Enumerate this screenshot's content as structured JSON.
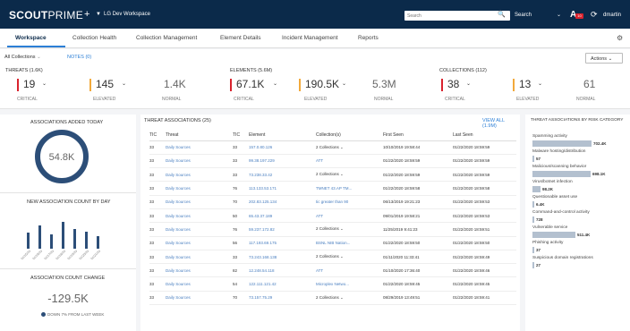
{
  "topbar": {
    "logo_bold": "SCOUT",
    "logo_thin": "PRIME",
    "workspace": "LG Dev Workspace",
    "search_placeholder": "Search",
    "search_select": "Search",
    "alert_count": "10",
    "user": "dmartin"
  },
  "tabs": [
    {
      "label": "Workspace"
    },
    {
      "label": "Collection Health"
    },
    {
      "label": "Collection Management"
    },
    {
      "label": "Element Details"
    },
    {
      "label": "Incident Management"
    },
    {
      "label": "Reports"
    }
  ],
  "filter": {
    "collections": "All Collections",
    "notes": "NOTES (0)",
    "actions": "Actions"
  },
  "stats": {
    "threats": {
      "title": "THREATS (1.6K)",
      "items": [
        {
          "value": "19",
          "label": "CRITICAL",
          "color": "#d9232e"
        },
        {
          "value": "145",
          "label": "ELEVATED",
          "color": "#f2a93b"
        },
        {
          "value": "1.4K",
          "label": "NORMAL",
          "color": ""
        }
      ]
    },
    "elements": {
      "title": "ELEMENTS (5.6M)",
      "items": [
        {
          "value": "67.1K",
          "label": "CRITICAL",
          "color": "#d9232e"
        },
        {
          "value": "190.5K",
          "label": "ELEVATED",
          "color": "#f2a93b"
        },
        {
          "value": "5.3M",
          "label": "NORMAL",
          "color": ""
        }
      ]
    },
    "collections": {
      "title": "COLLECTIONS (112)",
      "items": [
        {
          "value": "38",
          "label": "CRITICAL",
          "color": "#d9232e"
        },
        {
          "value": "13",
          "label": "ELEVATED",
          "color": "#f2a93b"
        },
        {
          "value": "61",
          "label": "NORMAL",
          "color": ""
        }
      ]
    }
  },
  "left": {
    "added_title": "ASSOCIATIONS ADDED TODAY",
    "added_value": "54.8K",
    "by_day_title": "NEW ASSOCIATION COUNT BY DAY",
    "by_day_bars": [
      0.55,
      0.8,
      0.5,
      0.95,
      0.7,
      0.6,
      0.45
    ],
    "by_day_ticks": [
      "01/15/20",
      "01/16/20",
      "01/17/20",
      "01/18/20",
      "01/19/20",
      "01/20/20",
      "01/21/20"
    ],
    "change_title": "ASSOCIATION COUNT CHANGE",
    "change_value": "-129.5K",
    "change_note": "DOWN 7% FROM LAST WEEK"
  },
  "assoc": {
    "title": "THREAT ASSOCIATIONS (25)",
    "view_all": "VIEW ALL (1.9M)",
    "columns": [
      "TIC",
      "Threat",
      "TIC",
      "Element",
      "Collection(s)",
      "First Seen",
      "Last Seen"
    ],
    "rows": [
      [
        "33",
        "Daily Sources",
        "33",
        "157.0.80.126",
        "2 Collections ⌄",
        "10/10/2019 19:58:44",
        "01/22/2020 18:59:59"
      ],
      [
        "33",
        "Daily Sources",
        "33",
        "99.38.197.229",
        "ATT",
        "01/22/2020 18:59:59",
        "01/22/2020 18:59:59"
      ],
      [
        "33",
        "Daily Sources",
        "33",
        "73.238.33.42",
        "2 Collections ⌄",
        "01/22/2020 18:59:59",
        "01/22/2020 18:59:59"
      ],
      [
        "33",
        "Daily Sources",
        "76",
        "113.133.53.171",
        "TMNET 43.AP TM...",
        "01/22/2020 18:59:58",
        "01/22/2020 18:59:58"
      ],
      [
        "33",
        "Daily Sources",
        "70",
        "202.83.125.134",
        "tic greater than 90",
        "06/13/2019 19:21:23",
        "01/22/2020 18:59:53"
      ],
      [
        "33",
        "Daily Sources",
        "50",
        "65.43.37.189",
        "ATT",
        "09/01/2019 19:58:21",
        "01/22/2020 18:59:53"
      ],
      [
        "33",
        "Daily Sources",
        "76",
        "59.237.172.82",
        "2 Collections ⌄",
        "11/25/2019 9:41:23",
        "01/22/2020 18:59:51"
      ],
      [
        "33",
        "Daily Sources",
        "56",
        "117.193.69.175",
        "BSNL NIB Nation...",
        "01/22/2020 18:59:50",
        "01/22/2020 18:59:50"
      ],
      [
        "33",
        "Daily Sources",
        "33",
        "73.243.168.138",
        "2 Collections ⌄",
        "01/11/2020 11:33:41",
        "01/22/2020 18:59:49"
      ],
      [
        "33",
        "Daily Sources",
        "82",
        "12.248.54.118",
        "ATT",
        "01/10/2020 17:36:40",
        "01/22/2020 18:59:46"
      ],
      [
        "33",
        "Daily Sources",
        "54",
        "122.111.121.42",
        "Microplex Netwo...",
        "01/22/2020 18:59:45",
        "01/22/2020 18:59:45"
      ],
      [
        "33",
        "Daily Sources",
        "70",
        "73.157.75.29",
        "2 Collections ⌄",
        "08/29/2019 13:49:51",
        "01/22/2020 18:59:41"
      ]
    ]
  },
  "risk": {
    "title": "THREAT ASSOCIATIONS BY RISK CATEGORY",
    "items": [
      {
        "label": "Spamming activity",
        "value": "702.4K",
        "fraction": 1.0
      },
      {
        "label": "Malware hosting/distribution",
        "value": "57",
        "fraction": 0
      },
      {
        "label": "Malicious/scanning behavior",
        "value": "698.1K",
        "fraction": 0.99
      },
      {
        "label": "Virus/botnet infection",
        "value": "98.2K",
        "fraction": 0.14
      },
      {
        "label": "Questionable asset use",
        "value": "6.4K",
        "fraction": 0.02
      },
      {
        "label": "Command-and-control activity",
        "value": "728",
        "fraction": 0
      },
      {
        "label": "Vulnerable service",
        "value": "511.4K",
        "fraction": 0.73
      },
      {
        "label": "Phishing activity",
        "value": "37",
        "fraction": 0
      },
      {
        "label": "Suspicious domain registrations",
        "value": "27",
        "fraction": 0
      }
    ]
  }
}
